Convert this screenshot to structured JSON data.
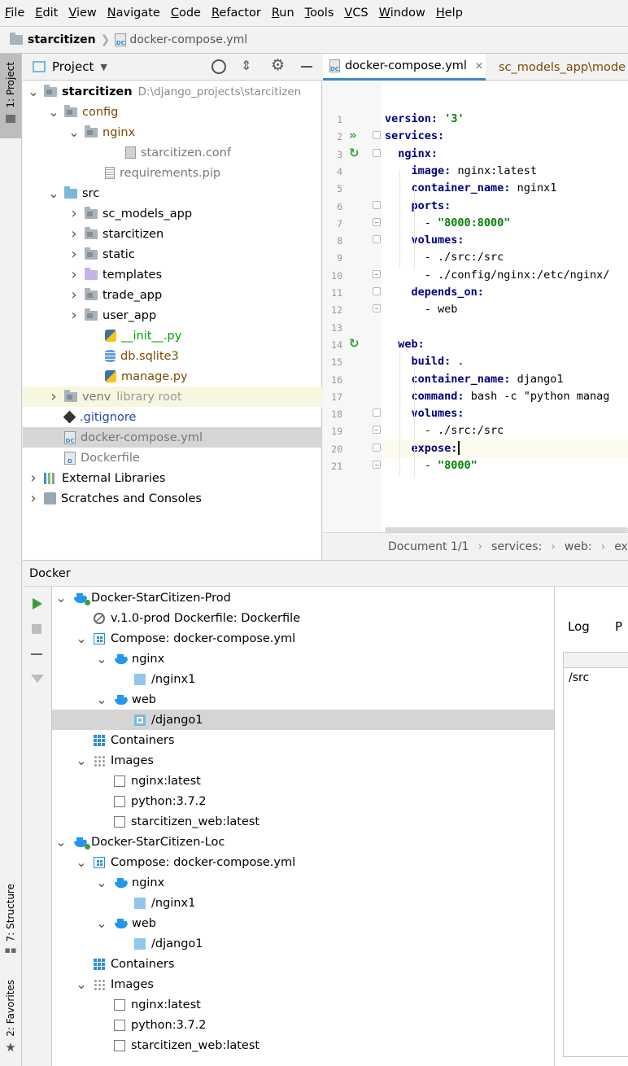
{
  "menu": [
    {
      "mn": "F",
      "rest": "ile"
    },
    {
      "mn": "E",
      "rest": "dit"
    },
    {
      "mn": "V",
      "rest": "iew"
    },
    {
      "mn": "N",
      "rest": "avigate"
    },
    {
      "mn": "C",
      "rest": "ode"
    },
    {
      "mn": "R",
      "rest": "efactor"
    },
    {
      "mn": "R",
      "rest": "un"
    },
    {
      "mn": "T",
      "rest": "ools"
    },
    {
      "mn": "V",
      "rest": "CS"
    },
    {
      "mn": "W",
      "rest": "indow"
    },
    {
      "mn": "H",
      "rest": "elp"
    }
  ],
  "navbar": {
    "project": "starcitizen",
    "file": "docker-compose.yml"
  },
  "left_stripe": {
    "project": "1: Project",
    "structure": "7: Structure",
    "favorites": "2: Favorites"
  },
  "project_panel": {
    "title": "Project",
    "tree": [
      {
        "label": "starcitizen",
        "path": "D:\\django_projects\\starcitizen"
      },
      {
        "label": "config"
      },
      {
        "label": "nginx"
      },
      {
        "label": "starcitizen.conf"
      },
      {
        "label": "requirements.pip"
      },
      {
        "label": "src"
      },
      {
        "label": "sc_models_app"
      },
      {
        "label": "starcitizen"
      },
      {
        "label": "static"
      },
      {
        "label": "templates"
      },
      {
        "label": "trade_app"
      },
      {
        "label": "user_app"
      },
      {
        "label": "__init__.py"
      },
      {
        "label": "db.sqlite3"
      },
      {
        "label": "manage.py"
      },
      {
        "label": "venv",
        "suffix": "library root"
      },
      {
        "label": ".gitignore"
      },
      {
        "label": "docker-compose.yml"
      },
      {
        "label": "Dockerfile"
      },
      {
        "label": "External Libraries"
      },
      {
        "label": "Scratches and Consoles"
      }
    ]
  },
  "editor": {
    "tabs": [
      {
        "label": "docker-compose.yml",
        "close": "✕"
      },
      {
        "label": "sc_models_app\\mode"
      }
    ],
    "lines": [
      {
        "n": "1",
        "ind": "",
        "k": "version",
        "v": "'3'"
      },
      {
        "n": "2",
        "ind": "",
        "k": "services",
        "v": ""
      },
      {
        "n": "3",
        "ind": "  ",
        "k": "nginx",
        "v": ""
      },
      {
        "n": "4",
        "ind": "    ",
        "k": "image",
        "v": "nginx:latest"
      },
      {
        "n": "5",
        "ind": "    ",
        "k": "container_name",
        "v": "nginx1"
      },
      {
        "n": "6",
        "ind": "    ",
        "k": "ports",
        "v": ""
      },
      {
        "n": "7",
        "ind": "      - ",
        "k": "",
        "v": "\"8000:8000\""
      },
      {
        "n": "8",
        "ind": "    ",
        "k": "volumes",
        "v": ""
      },
      {
        "n": "9",
        "ind": "      - ",
        "k": "",
        "v": "./src:/src"
      },
      {
        "n": "10",
        "ind": "      - ",
        "k": "",
        "v": "./config/nginx:/etc/nginx/"
      },
      {
        "n": "11",
        "ind": "    ",
        "k": "depends_on",
        "v": ""
      },
      {
        "n": "12",
        "ind": "      - ",
        "k": "",
        "v": "web"
      },
      {
        "n": "13",
        "ind": "",
        "k": "",
        "v": ""
      },
      {
        "n": "14",
        "ind": "  ",
        "k": "web",
        "v": ""
      },
      {
        "n": "15",
        "ind": "    ",
        "k": "build",
        "v": "."
      },
      {
        "n": "16",
        "ind": "    ",
        "k": "container_name",
        "v": "django1"
      },
      {
        "n": "17",
        "ind": "    ",
        "k": "command",
        "v": "bash -c \"python manag"
      },
      {
        "n": "18",
        "ind": "    ",
        "k": "volumes",
        "v": ""
      },
      {
        "n": "19",
        "ind": "      - ",
        "k": "",
        "v": "./src:/src"
      },
      {
        "n": "20",
        "ind": "    ",
        "k": "expose",
        "v": ""
      },
      {
        "n": "21",
        "ind": "      - ",
        "k": "",
        "v": "\"8000\""
      }
    ],
    "breadcrumb": [
      "Document 1/1",
      "services:",
      "web:",
      "expo"
    ]
  },
  "docker": {
    "title": "Docker",
    "tree": [
      {
        "label": "Docker-StarCitizen-Prod"
      },
      {
        "label": "v.1.0-prod Dockerfile: Dockerfile"
      },
      {
        "label": "Compose: docker-compose.yml"
      },
      {
        "label": "nginx"
      },
      {
        "label": "/nginx1"
      },
      {
        "label": "web"
      },
      {
        "label": "/django1"
      },
      {
        "label": "Containers"
      },
      {
        "label": "Images"
      },
      {
        "label": "nginx:latest"
      },
      {
        "label": "python:3.7.2"
      },
      {
        "label": "starcitizen_web:latest"
      },
      {
        "label": "Docker-StarCitizen-Loc"
      },
      {
        "label": "Compose: docker-compose.yml"
      },
      {
        "label": "nginx"
      },
      {
        "label": "/nginx1"
      },
      {
        "label": "web"
      },
      {
        "label": "/django1"
      },
      {
        "label": "Containers"
      },
      {
        "label": "Images"
      },
      {
        "label": "nginx:latest"
      },
      {
        "label": "python:3.7.2"
      },
      {
        "label": "starcitizen_web:latest"
      }
    ],
    "log_tab": "Log",
    "p_tab": "P",
    "log_value": "/src"
  },
  "colors": {
    "accent": "#2b8fd6",
    "selection": "#d5d5d5",
    "venv_bg": "#f7f7e0",
    "yaml_key": "#000080",
    "yaml_str": "#008000",
    "link_green": "#00a000"
  }
}
